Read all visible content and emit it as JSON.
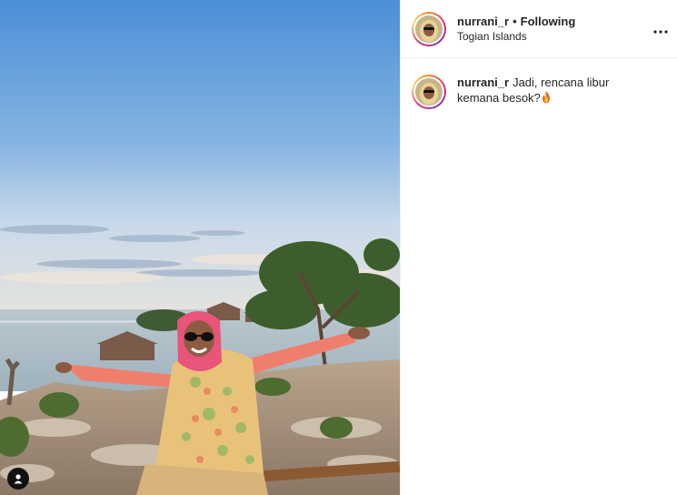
{
  "post": {
    "username": "nurrani_r",
    "separator": "•",
    "follow_status": "Following",
    "location": "Togian Islands",
    "more_icon": "more-horizontal-icon"
  },
  "caption": {
    "username": "nurrani_r",
    "text": "Jadi, rencana libur kemana besok?",
    "emoji_icon": "fire-emoji-icon"
  },
  "photo": {
    "user_tag_icon": "user-tag-icon",
    "sky_top": "#4f93d8",
    "sky_bottom": "#dfe6ee",
    "scarf_color": "#e8547a",
    "sleeve_color": "#ef7e6d"
  }
}
